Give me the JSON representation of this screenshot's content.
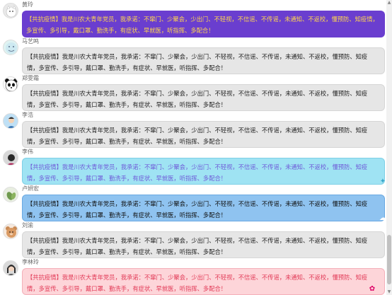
{
  "messages": [
    {
      "name": "黄玲",
      "style": "purple",
      "avatar": "avatar-cat",
      "text": "【共抗疫情】我是川农大青年党员，我承诺：不窜门、少聚会，少出门、不轻视，不信谣、不传谣，未通知、不返校，懂预防、知疫情，多宣传、多引导，戴口罩、勤洗手，有症状、早就医，听指挥、多配合！"
    },
    {
      "name": "马艺鸣",
      "style": "gray",
      "avatar": "avatar-cartoon",
      "text": "【共抗疫情】我是川农大青年党员，我承诺：不窜门、少聚会，少出门、不轻视，不信谣、不传谣，未通知、不返校，懂预防、知疫情，多宣传、多引导，戴口罩、勤洗手，有症状、早就医，听指挥、多配合！"
    },
    {
      "name": "郑雯霜",
      "style": "gray",
      "avatar": "avatar-panda",
      "text": "【共抗疫情】我是川农大青年党员，我承诺：不窜门、少聚会，少出门、不轻视，不信谣、不传谣，未通知、不返校，懂预防、知疫情，多宣传、多引导，戴口罩、勤洗手，有症状、早就医，听指挥、多配合！"
    },
    {
      "name": "李浩",
      "style": "gray",
      "avatar": "avatar-person",
      "text": "【共抗疫情】我是川农大青年党员，我承诺：不窜门、少聚会，少出门、不轻视，不信谣、不传谣，未通知、不返校，懂预防、知疫情，多宣传、多引导，戴口罩、勤洗手，有症状、早就医，听指挥、多配合！"
    },
    {
      "name": "李伟",
      "style": "cyan",
      "avatar": "avatar-dark",
      "text": "【共抗疫情】我是川农大青年党员，我承诺：不窜门、少聚会，少出门、不轻视，不信谣、不传谣，未通知、不返校，懂预防、知疫情，多宣传、多引导，戴口罩、勤洗手，有症状、早就医，听指挥、多配合！"
    },
    {
      "name": "卢妍宏",
      "style": "blue",
      "avatar": "avatar-plant",
      "text": "【共抗疫情】我是川农大青年党员，我承诺：不窜门、少聚会，少出门、不轻视，不信谣、不传谣，未通知、不返校，懂预防、知疫情，多宣传、多引导，戴口罩、勤洗手，有症状、早就医，听指挥、多配合！"
    },
    {
      "name": "刘渝",
      "style": "gray",
      "avatar": "avatar-bear",
      "text": "【共抗疫情】我是川农大青年党员，我承诺：不窜门、少聚会，少出门、不轻视，不信谣、不传谣，未通知、不返校，懂预防、知疫情，多宣传、多引导，戴口罩、勤洗手，有症状、早就医，听指挥、多配合！"
    },
    {
      "name": "李林玲",
      "style": "pink",
      "avatar": "avatar-girl",
      "text": "【共抗疫情】我是川农大青年党员，我承诺：不窜门、少聚会，少出门、不轻视，不信谣、不传谣，未通知、不返校，懂预防、知疫情，多宣传、多引导，戴口罩、勤洗手，有症状、早就医，听指挥、多配合！"
    }
  ],
  "colors": {
    "purple_bubble": "#6a3ecf",
    "purple_text": "#ffd54f",
    "gray_bubble": "#e6e6e6",
    "cyan_bubble": "#9fe3f3",
    "cyan_text": "#6f5bd8",
    "blue_bubble": "#8fc3f0",
    "pink_bubble": "#fdd5d9",
    "pink_text": "#e23a57"
  }
}
